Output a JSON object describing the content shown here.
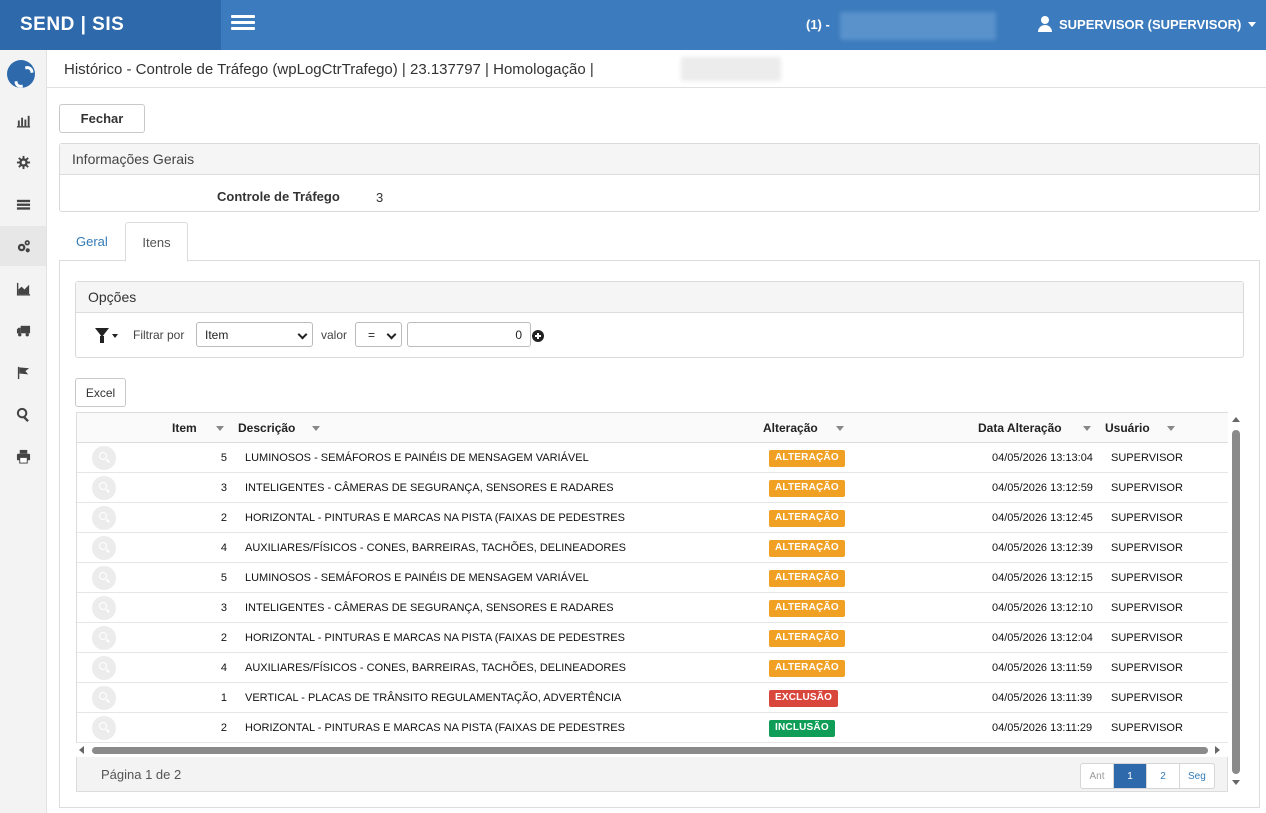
{
  "topbar": {
    "brand": "SEND | SIS",
    "counter": "(1) -",
    "user": "SUPERVISOR (SUPERVISOR)"
  },
  "sidebar": {
    "items": [
      {
        "icon": "bar-chart-icon"
      },
      {
        "icon": "gear-icon"
      },
      {
        "icon": "list-icon"
      },
      {
        "icon": "gears-icon",
        "active": true
      },
      {
        "icon": "area-chart-icon"
      },
      {
        "icon": "truck-icon"
      },
      {
        "icon": "flag-icon"
      },
      {
        "icon": "search-icon"
      },
      {
        "icon": "print-icon"
      }
    ]
  },
  "page": {
    "title": "Histórico - Controle de Tráfego (wpLogCtrTrafego) | 23.137797 | Homologação |"
  },
  "buttons": {
    "fechar": "Fechar",
    "excel": "Excel"
  },
  "info_panel": {
    "title": "Informações Gerais",
    "label": "Controle de Tráfego",
    "value": "3"
  },
  "tabs": [
    {
      "label": "Geral"
    },
    {
      "label": "Itens",
      "active": true
    }
  ],
  "options_panel": {
    "title": "Opções",
    "filter_label": "Filtrar por",
    "filter_field": "Item",
    "valor_label": "valor",
    "operator": "=",
    "value": "0"
  },
  "grid": {
    "columns": [
      "Item",
      "Descrição",
      "Alteração",
      "Data Alteração",
      "Usuário"
    ],
    "rows": [
      {
        "item": "5",
        "descricao": "LUMINOSOS - SEMÁFOROS E PAINÉIS DE MENSAGEM VARIÁVEL",
        "alteracao": "ALTERAÇÃO",
        "data": "04/05/2026 13:13:04",
        "usuario": "SUPERVISOR"
      },
      {
        "item": "3",
        "descricao": "INTELIGENTES - CÂMERAS DE SEGURANÇA, SENSORES E RADARES",
        "alteracao": "ALTERAÇÃO",
        "data": "04/05/2026 13:12:59",
        "usuario": "SUPERVISOR"
      },
      {
        "item": "2",
        "descricao": "HORIZONTAL - PINTURAS E MARCAS NA PISTA (FAIXAS DE PEDESTRES",
        "alteracao": "ALTERAÇÃO",
        "data": "04/05/2026 13:12:45",
        "usuario": "SUPERVISOR"
      },
      {
        "item": "4",
        "descricao": "AUXILIARES/FÍSICOS - CONES, BARREIRAS, TACHÕES, DELINEADORES",
        "alteracao": "ALTERAÇÃO",
        "data": "04/05/2026 13:12:39",
        "usuario": "SUPERVISOR"
      },
      {
        "item": "5",
        "descricao": "LUMINOSOS - SEMÁFOROS E PAINÉIS DE MENSAGEM VARIÁVEL",
        "alteracao": "ALTERAÇÃO",
        "data": "04/05/2026 13:12:15",
        "usuario": "SUPERVISOR"
      },
      {
        "item": "3",
        "descricao": "INTELIGENTES - CÂMERAS DE SEGURANÇA, SENSORES E RADARES",
        "alteracao": "ALTERAÇÃO",
        "data": "04/05/2026 13:12:10",
        "usuario": "SUPERVISOR"
      },
      {
        "item": "2",
        "descricao": "HORIZONTAL - PINTURAS E MARCAS NA PISTA (FAIXAS DE PEDESTRES",
        "alteracao": "ALTERAÇÃO",
        "data": "04/05/2026 13:12:04",
        "usuario": "SUPERVISOR"
      },
      {
        "item": "4",
        "descricao": "AUXILIARES/FÍSICOS - CONES, BARREIRAS, TACHÕES, DELINEADORES",
        "alteracao": "ALTERAÇÃO",
        "data": "04/05/2026 13:11:59",
        "usuario": "SUPERVISOR"
      },
      {
        "item": "1",
        "descricao": "VERTICAL - PLACAS DE TRÂNSITO REGULAMENTAÇÃO, ADVERTÊNCIA",
        "alteracao": "EXCLUSÃO",
        "data": "04/05/2026 13:11:39",
        "usuario": "SUPERVISOR"
      },
      {
        "item": "2",
        "descricao": "HORIZONTAL - PINTURAS E MARCAS NA PISTA (FAIXAS DE PEDESTRES",
        "alteracao": "INCLUSÃO",
        "data": "04/05/2026 13:11:29",
        "usuario": "SUPERVISOR"
      }
    ],
    "badge_colors": {
      "ALTERAÇÃO": "#f0a023",
      "EXCLUSÃO": "#d9473c",
      "INCLUSÃO": "#0f9d58"
    }
  },
  "pager": {
    "info": "Página 1 de 2",
    "prev": "Ant",
    "pages": [
      "1",
      "2"
    ],
    "current": "1",
    "next": "Seg"
  }
}
